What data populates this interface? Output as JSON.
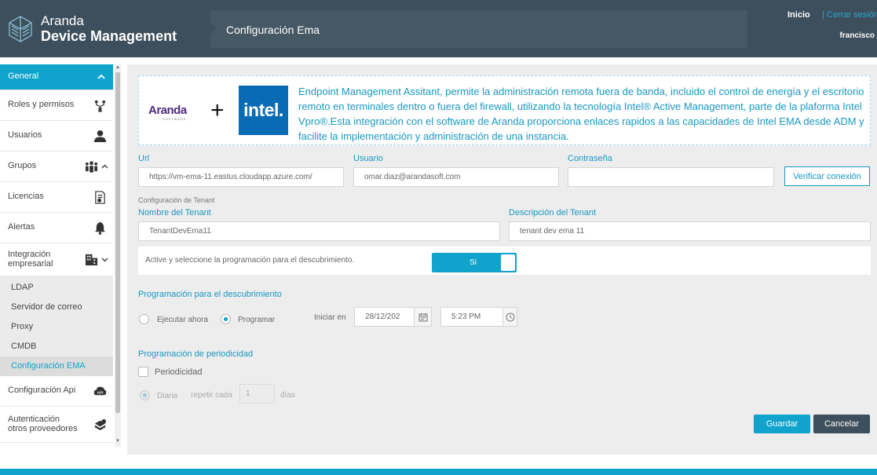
{
  "header": {
    "brand_line1": "Aranda",
    "brand_line2": "Device Management",
    "title": "Configuración Ema",
    "inicio": "Inicio",
    "cerrar_sesion": "| Cerrar sesión",
    "user": "francisco"
  },
  "sidebar": {
    "general": "General",
    "items": [
      {
        "label": "Roles y permisos",
        "icon": "roles-icon"
      },
      {
        "label": "Usuarios",
        "icon": "user-icon"
      },
      {
        "label": "Grupos",
        "icon": "group-icon"
      },
      {
        "label": "Licencias",
        "icon": "license-icon"
      },
      {
        "label": "Alertas",
        "icon": "bell-icon"
      },
      {
        "label_line1": "Integración",
        "label_line2": "empresarial",
        "icon": "building-icon"
      },
      {
        "label": "Configuración Api",
        "icon": "api-icon",
        "badge": "API"
      },
      {
        "label_line1": "Autenticación",
        "label_line2": "otros proveedores",
        "icon": "auth-icon"
      }
    ],
    "subitems": [
      "LDAP",
      "Servidor de correo",
      "Proxy",
      "CMDB",
      "Configuración EMA"
    ]
  },
  "info": {
    "aranda_logo": "Aranda",
    "aranda_sub": "SOFTWARE",
    "plus": "+",
    "intel_logo": "intel.",
    "text": "Endpoint Management Assitant, permite la administración remota fuera de banda, incluido el control de energía y el escritorio remoto en terminales dentro o fuera del firewall, utilizando la tecnología Intel® Active Management, parte de la plaforma Intel Vpro®.Esta integración con el software de Aranda proporciona enlaces rapidos a las capacidades de Intel EMA desde ADM y facilite la implementación y administración de una instancia."
  },
  "form": {
    "url_label": "Url",
    "url_value": "https://vm-ema-11.eastus.cloudapp.azure.com/",
    "usuario_label": "Usuario",
    "usuario_value": "omar.diaz@arandasoft.com",
    "password_label": "Contraseña",
    "password_value": "",
    "verify_button": "Verificar conexión",
    "tenant_section": "Configuración de Tenant",
    "tenant_name_label": "Nombre del Tenant",
    "tenant_name_value": "TenantDevEma11",
    "tenant_desc_label": "Descripción del Tenant",
    "tenant_desc_value": "tenant dev ema 11",
    "toggle_text": "Active y seleccione la programación para el descubrimiento.",
    "toggle_label": "Si",
    "toggle_on": true
  },
  "schedule": {
    "title": "Programación para el descubrimiento",
    "option_now": "Ejecutar ahora",
    "option_schedule": "Programar",
    "selected": "Programar",
    "start_label": "Iniciar en",
    "date_value": "28/12/202",
    "time_value": "5:23 PM"
  },
  "periodicity": {
    "title": "Programación de periodicidad",
    "checkbox_label": "Periodicidad",
    "checked": false,
    "daily_label": "Diaria",
    "repeat_label": "repetir cada",
    "repeat_value": "1",
    "days_label": "días"
  },
  "actions": {
    "save": "Guardar",
    "cancel": "Cancelar"
  },
  "colors": {
    "accent": "#10a3cc",
    "header": "#3d4f5c",
    "link": "#1898c2"
  }
}
